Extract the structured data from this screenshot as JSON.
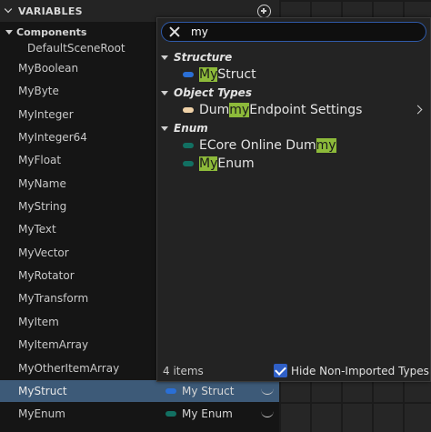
{
  "panel": {
    "title": "VARIABLES",
    "section": "Components",
    "root": "DefaultSceneRoot",
    "variables": [
      "MyBoolean",
      "MyByte",
      "MyInteger",
      "MyInteger64",
      "MyFloat",
      "MyName",
      "MyString",
      "MyText",
      "MyVector",
      "MyRotator",
      "MyTransform",
      "MyItem",
      "MyItemArray",
      "MyOtherItemArray",
      "MyStruct",
      "MyEnum"
    ],
    "selected": "MyStruct",
    "types": {
      "MyStruct": {
        "label": "My Struct",
        "color": "#2a6fd6"
      },
      "MyEnum": {
        "label": "My Enum",
        "color": "#127062"
      }
    }
  },
  "popup": {
    "search_value": "my",
    "categories": {
      "structure": "Structure",
      "object_types": "Object Types",
      "enum": "Enum"
    },
    "items": {
      "my_struct": {
        "pre": "",
        "hl": "My",
        "post": " Struct",
        "color": "#2a6fd6"
      },
      "dummy_endpoint": {
        "pre": "Dum",
        "hl": "my",
        "post": " Endpoint Settings",
        "color": "#f0d2a8"
      },
      "ecore_online": {
        "pre": "ECore Online Dum",
        "hl": "my",
        "post": "",
        "color": "#127062"
      },
      "my_enum": {
        "pre": "",
        "hl": "My",
        "post": " Enum",
        "color": "#127062"
      }
    },
    "footer": {
      "count": "4 items",
      "checkbox_label": "Hide Non-Imported Types"
    }
  },
  "colors": {
    "highlight": "#8dba3a",
    "selection": "#3d5a78",
    "accent": "#2f5fc6"
  }
}
